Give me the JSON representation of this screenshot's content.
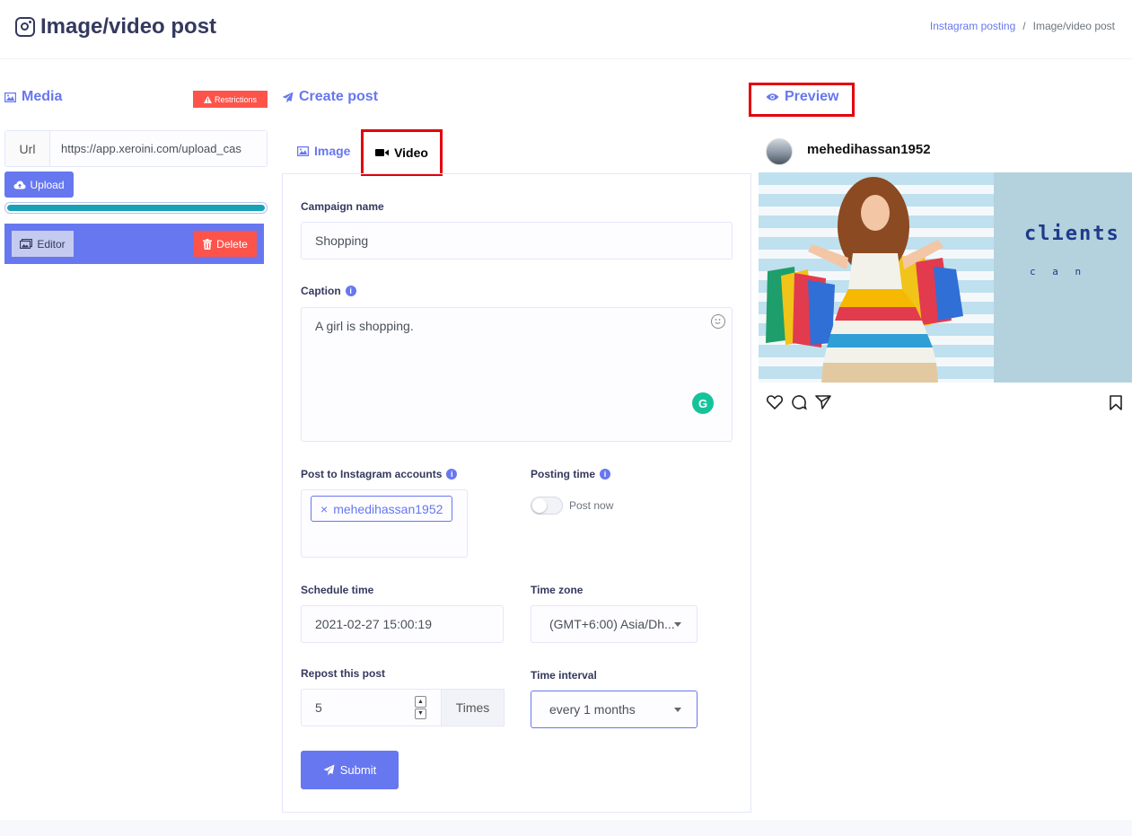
{
  "header": {
    "title": "Image/video post",
    "breadcrumb": [
      "Instagram posting",
      "Image/video post"
    ]
  },
  "media": {
    "heading": "Media",
    "restrictions_label": "Restrictions",
    "url_label": "Url",
    "url_value": "https://app.xeroini.com/upload_cas",
    "upload_label": "Upload",
    "progress_percent": 100,
    "editor_label": "Editor",
    "delete_label": "Delete"
  },
  "create_post": {
    "heading": "Create post",
    "tabs": [
      {
        "label": "Image",
        "active": false
      },
      {
        "label": "Video",
        "active": true
      }
    ],
    "campaign_name_label": "Campaign name",
    "campaign_name_value": "Shopping",
    "caption_label": "Caption",
    "caption_value": "A girl is shopping.",
    "accounts_label": "Post to Instagram accounts",
    "accounts": [
      "mehedihassan1952"
    ],
    "posting_time_label": "Posting time",
    "post_now_label": "Post now",
    "post_now_on": false,
    "schedule_time_label": "Schedule time",
    "schedule_time_value": "2021-02-27 15:00:19",
    "time_zone_label": "Time zone",
    "time_zone_value": "(GMT+6:00) Asia/Dh...",
    "repost_label": "Repost this post",
    "repost_value": "5",
    "times_label": "Times",
    "time_interval_label": "Time interval",
    "time_interval_value": "every 1 months",
    "submit_label": "Submit"
  },
  "preview": {
    "heading": "Preview",
    "username": "mehedihassan1952",
    "image_text_1": "clients",
    "image_text_2": "c a n"
  },
  "colors": {
    "primary": "#6777ef",
    "danger": "#fc544b",
    "progress": "#17a2b8",
    "highlight": "#e3000b"
  }
}
